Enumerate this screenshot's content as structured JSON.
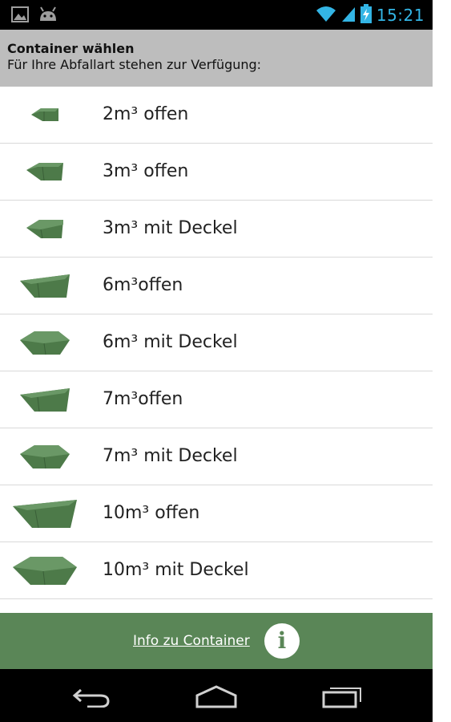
{
  "status_bar": {
    "time": "15:21",
    "icons": [
      "image-icon",
      "android-icon",
      "wifi-icon",
      "signal-icon",
      "battery-charging-icon"
    ]
  },
  "header": {
    "title": "Container wählen",
    "subtitle": "Für Ihre Abfallart stehen zur Verfügung:"
  },
  "containers": [
    {
      "label": "2m³ offen",
      "icon": "container-open-icon"
    },
    {
      "label": "3m³ offen",
      "icon": "container-open-icon"
    },
    {
      "label": "3m³ mit Deckel",
      "icon": "container-lid-icon"
    },
    {
      "label": "6m³offen",
      "icon": "container-open-icon"
    },
    {
      "label": "6m³ mit Deckel",
      "icon": "container-lid-icon"
    },
    {
      "label": "7m³offen",
      "icon": "container-open-icon"
    },
    {
      "label": "7m³ mit Deckel",
      "icon": "container-lid-icon"
    },
    {
      "label": "10m³ offen",
      "icon": "container-open-icon"
    },
    {
      "label": "10m³ mit Deckel",
      "icon": "container-lid-icon"
    }
  ],
  "footer": {
    "info_link": "Info zu Container",
    "info_icon": "info-icon"
  },
  "nav_bar": {
    "icons": [
      "back-icon",
      "home-icon",
      "recent-apps-icon"
    ]
  },
  "colors": {
    "accent_green": "#5a8657",
    "container_green": "#4d7a49",
    "header_gray": "#bdbdbd",
    "clock_blue": "#33b5e5"
  }
}
